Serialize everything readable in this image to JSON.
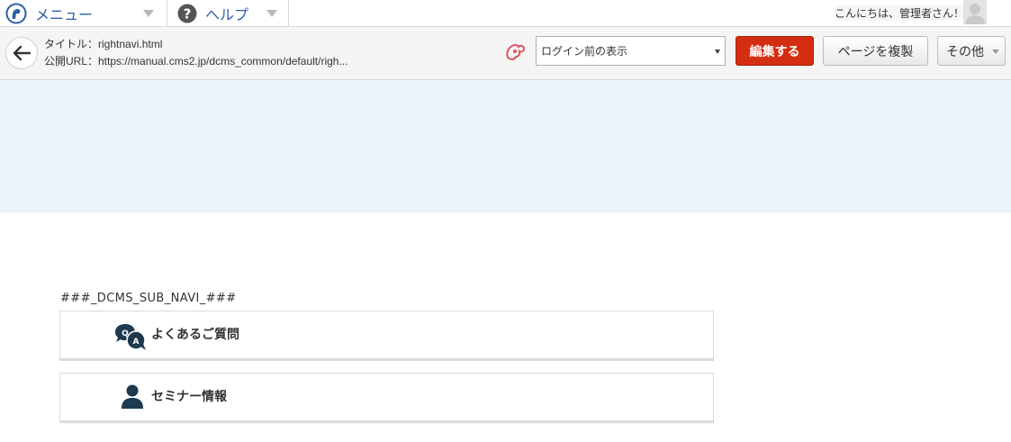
{
  "topbar": {
    "menu_label": "メニュー",
    "help_label": "ヘルプ"
  },
  "toolbar": {
    "title_line": "タイトル：rightnavi.html",
    "url_line": "公開URL：https://manual.cms2.jp/dcms_common/default/righ...",
    "view_select_value": "ログイン前の表示",
    "edit_label": "編集する",
    "copy_label": "ページを複製",
    "other_label": "その他",
    "greeting": "こんにちは、管理者さん！"
  },
  "content": {
    "marker": "###_DCMS_SUB_NAVI_###",
    "nav_items": [
      {
        "label": "よくあるご質問",
        "icon": "qa-bubbles-icon"
      },
      {
        "label": "セミナー情報",
        "icon": "person-icon"
      }
    ]
  },
  "colors": {
    "accent_blue": "#2c5fa8",
    "edit_red": "#d42e12",
    "band": "#edf3fb",
    "icon_dark": "#1e3a4f"
  }
}
